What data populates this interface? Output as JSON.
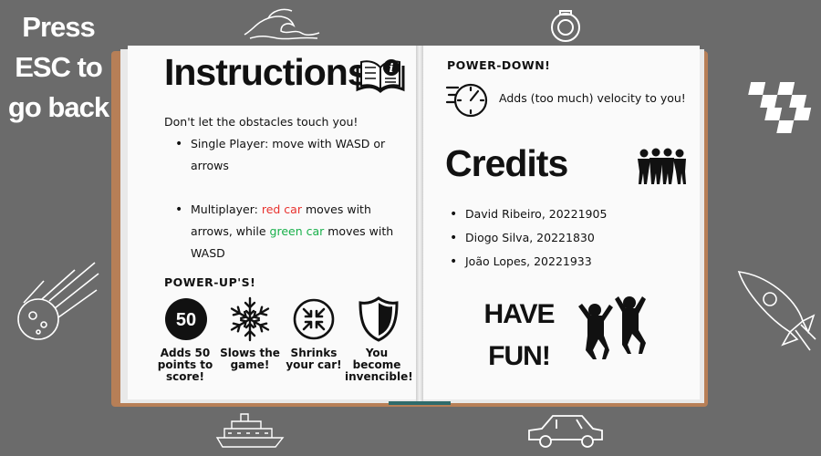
{
  "esc_hint": [
    "Press",
    "ESC to",
    "go back"
  ],
  "instructions": {
    "title": "Instructions",
    "intro": "Don't let the obstacles touch you!",
    "single_player": "Single Player: move with WASD or",
    "single_player_2": "arrows",
    "multi_1": "Multiplayer: ",
    "multi_red": "red car",
    "multi_2": " moves with",
    "multi_3": "arrows, while ",
    "multi_green": "green car",
    "multi_4": " moves with",
    "multi_5": "WASD",
    "powerups_title": "POWER-UP'S!",
    "powerups": [
      {
        "icon": "50-points-icon",
        "badge": "50",
        "label": "Adds 50 points to score!"
      },
      {
        "icon": "snowflake-icon",
        "label": "Slows the game!"
      },
      {
        "icon": "shrink-icon",
        "label": "Shrinks your car!"
      },
      {
        "icon": "shield-icon",
        "label": "You become invencible!"
      }
    ]
  },
  "powerdown": {
    "title": "POWER-DOWN!",
    "icon": "speedometer-icon",
    "label": "Adds (too much) velocity to you!"
  },
  "credits": {
    "title": "Credits",
    "icon": "group-icon",
    "people": [
      "David Ribeiro, 20221905",
      "Diogo Silva, 20221830",
      "João Lopes, 20221933"
    ]
  },
  "have_fun": [
    "HAVE",
    "FUN!"
  ],
  "colors": {
    "background": "#6b6b6b",
    "cover": "#b77f57",
    "red_car": "#e8322e",
    "green_car": "#19b04b"
  }
}
